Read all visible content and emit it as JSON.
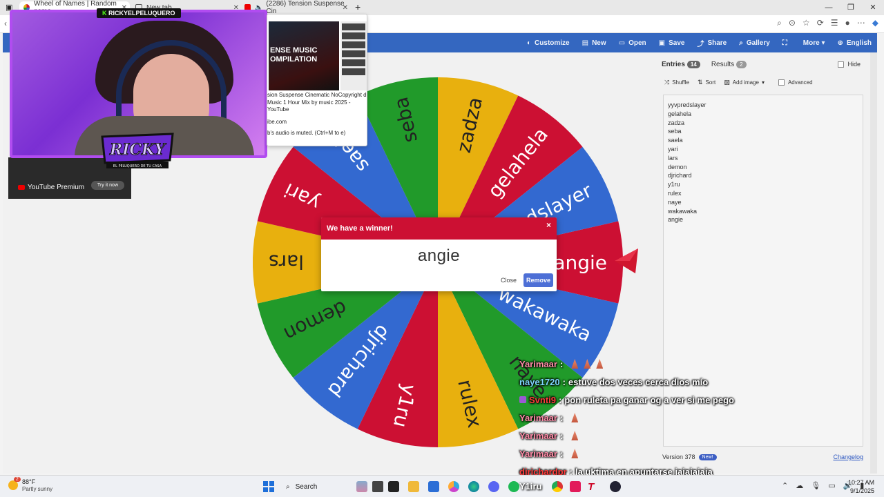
{
  "browser": {
    "tabs": [
      {
        "label": "Wheel of Names | Random name",
        "color": "#4285f4"
      },
      {
        "label": "New tab",
        "color": "#777777"
      },
      {
        "label": "(2286) Tension Suspense Cin",
        "color": "#e00000"
      }
    ],
    "window_controls": [
      "—",
      "❐",
      "✕"
    ]
  },
  "app": {
    "menu": [
      {
        "label": "Customize",
        "icon": "palette-icon",
        "glyph": "◐"
      },
      {
        "label": "New",
        "icon": "file-icon",
        "glyph": "▤"
      },
      {
        "label": "Open",
        "icon": "folder-icon",
        "glyph": "▭"
      },
      {
        "label": "Save",
        "icon": "save-icon",
        "glyph": "▣"
      },
      {
        "label": "Share",
        "icon": "share-icon",
        "glyph": "⤴"
      },
      {
        "label": "Gallery",
        "icon": "search-icon",
        "glyph": "⌕"
      },
      {
        "label": "",
        "icon": "fullscreen-icon",
        "glyph": "⛶"
      },
      {
        "label": "More ▾",
        "icon": "more-icon",
        "glyph": ""
      },
      {
        "label": "English",
        "icon": "globe-icon",
        "glyph": "⊕"
      }
    ],
    "accent": "#3467c0"
  },
  "wheel": {
    "segments": [
      {
        "label": "angie",
        "color": "#cc1033"
      },
      {
        "label": "wakawaka",
        "color": "#3369d0"
      },
      {
        "label": "naye",
        "color": "#219a2a"
      },
      {
        "label": "rulex",
        "color": "#e8b00e"
      },
      {
        "label": "y1ru",
        "color": "#cc1033"
      },
      {
        "label": "djrichard",
        "color": "#3369d0"
      },
      {
        "label": "demon",
        "color": "#219a2a"
      },
      {
        "label": "lars",
        "color": "#e8b00e"
      },
      {
        "label": "yari",
        "color": "#cc1033"
      },
      {
        "label": "saela",
        "color": "#3369d0"
      },
      {
        "label": "seba",
        "color": "#219a2a"
      },
      {
        "label": "zadza",
        "color": "#e8b00e"
      },
      {
        "label": "gelahela",
        "color": "#cc1033"
      },
      {
        "label": "yyvpredslayer",
        "color": "#3369d0"
      }
    ]
  },
  "panel": {
    "entries_tab": "Entries",
    "entries_count": "14",
    "results_tab": "Results",
    "results_count": "2",
    "hide_label": "Hide",
    "toolbar": {
      "shuffle": "Shuffle",
      "sort": "Sort",
      "add_image": "Add image",
      "advanced": "Advanced"
    },
    "entries": [
      "yyvpredslayer",
      "gelahela",
      "zadza",
      "seba",
      "saela",
      "yari",
      "lars",
      "demon",
      "djrichard",
      "y1ru",
      "rulex",
      "naye",
      "wakawaka",
      "angie"
    ],
    "version": "Version 378",
    "new_badge": "New!",
    "changelog": "Changelog"
  },
  "dialog": {
    "title": "We have a winner!",
    "close_x": "×",
    "winner": "angie",
    "close_label": "Close",
    "remove_label": "Remove",
    "header_color": "#cc1033"
  },
  "overlay": {
    "cam_label_k": "K",
    "cam_label": "RICKYELPELUQUERO",
    "logo_text": "RICKY",
    "logo_sub": "EL PELUQUERO DE TU CASA"
  },
  "yt_premium": {
    "label": "YouTube Premium",
    "try": "Try it now"
  },
  "preview": {
    "thumb_title": "ENSE MUSIC\nOMPILATION",
    "title": "sion Suspense Cinematic NoCopyright d Music 1 Hour Mix by music 2025 - YouTube",
    "domain": "ibe.com",
    "muted": "b's audio is muted. (Ctrl+M to e)"
  },
  "chat": [
    {
      "user": "Yarimaar",
      "user_color": "#ff8ca8",
      "sep": ":",
      "text": "",
      "emotes": 3
    },
    {
      "user": "naye1720",
      "user_color": "#7fd6ff",
      "sep": ":",
      "text": "estuve dos veces cerca dios mío",
      "emotes": 0
    },
    {
      "user": "Svnti9",
      "user_color": "#ff3b3b",
      "sep": ":",
      "text": "pon ruleta pa ganar og a ver si me pego",
      "emotes": 0
    },
    {
      "user": "Yarimaar",
      "user_color": "#ff8ca8",
      "sep": ":",
      "text": "",
      "emotes": 1
    },
    {
      "user": "Yarimaar",
      "user_color": "#ff8ca8",
      "sep": ":",
      "text": "",
      "emotes": 1
    },
    {
      "user": "Yarimaar",
      "user_color": "#ff8ca8",
      "sep": ":",
      "text": "",
      "emotes": 1
    },
    {
      "user": "djrichardpr",
      "user_color": "#ff3b3b",
      "sep": ":",
      "text": "la uktima en apuntarse jajajajaja",
      "emotes": 0
    }
  ],
  "taskbar": {
    "temp": "88°F",
    "weather": "Partly sunny",
    "alert": "2",
    "search": "Search",
    "stream_label": "Y1iru",
    "time": "10:27 AM",
    "date": "9/1/2025"
  }
}
